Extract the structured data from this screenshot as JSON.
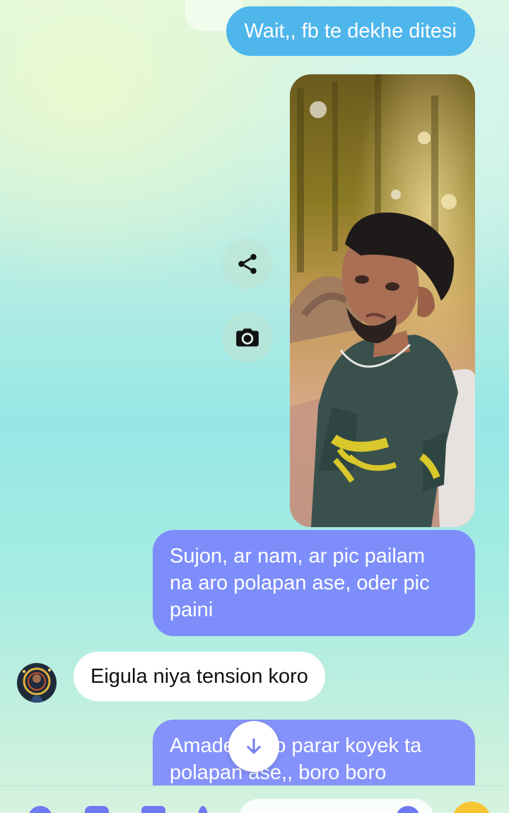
{
  "messages": {
    "m1": "Wait,, fb te dekhe ditesi",
    "m2": "Sujon,  ar nam,  ar pic pailam\nna aro polapan ase, oder pic\npaini",
    "m3": "Eigula niya tension koro",
    "m4": "Amader jotto parar koyek ta\npolapan ase,,  boro boro"
  },
  "icons": {
    "share": "share-icon",
    "camera": "camera-icon",
    "scroll": "arrow-down-icon",
    "emoji": "emoji-icon"
  },
  "colors": {
    "sent_blue": "#4fb6ec",
    "sent_purple": "#7d8efb",
    "received": "#ffffff",
    "accent": "#6f79f2"
  }
}
